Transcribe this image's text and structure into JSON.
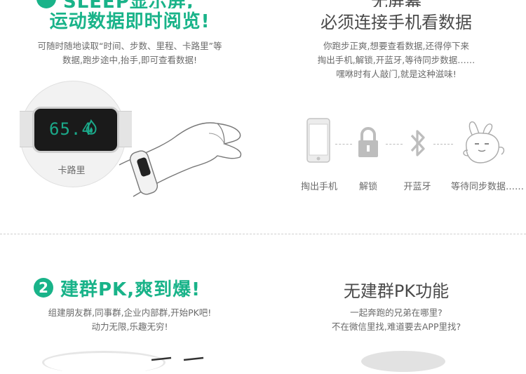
{
  "section1": {
    "left_title_top": "SLEEP显示屏,",
    "left_title": "运动数据即时阅览!",
    "left_desc_line1": "可随时随地读取“时间、步数、里程、卡路里”等",
    "left_desc_line2": "数据,跑步途中,抬手,即可查看数据!",
    "display_value": "65.4",
    "display_caption": "卡路里",
    "right_title_top": "无屏幕",
    "right_title": "必须连接手机看数据",
    "right_desc_line1": "你跑步正爽,想要查看数据,还得停下来",
    "right_desc_line2": "掏出手机,解锁,开蓝牙,等待同步数据……",
    "right_desc_line3": "嘿咻时有人敲门,就是这种滋味!",
    "steps": [
      {
        "icon": "phone-icon",
        "label": "掏出手机"
      },
      {
        "icon": "lock-icon",
        "label": "解锁"
      },
      {
        "icon": "bluetooth-icon",
        "label": "开蓝牙"
      },
      {
        "icon": "rabbit-icon",
        "label": "等待同步数据……"
      }
    ]
  },
  "section2": {
    "number": "2",
    "left_title": "建群PK,爽到爆!",
    "left_desc_line1": "组建朋友群,同事群,企业内部群,开始PK吧!",
    "left_desc_line2": "动力无限,乐趣无穷!",
    "right_title": "无建群PK功能",
    "right_desc_line1": "一起奔跑的兄弟在哪里?",
    "right_desc_line2": "不在微信里找,难道要去APP里找?"
  },
  "colors": {
    "accent": "#19b389",
    "text": "#555555",
    "title_gray": "#4a4a4a"
  }
}
